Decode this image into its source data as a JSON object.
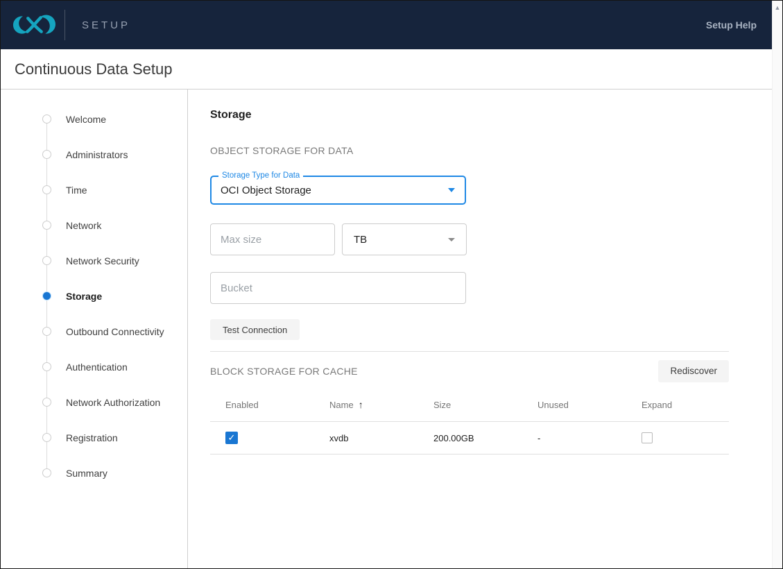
{
  "colors": {
    "header_bg": "#16243C",
    "logo_teal": "#15A4BF",
    "accent_blue": "#1E88E5",
    "active_step_blue": "#1976D2",
    "checkbox_blue": "#1976D2"
  },
  "header": {
    "product_label": "SETUP",
    "help_label": "Setup Help"
  },
  "page_title": "Continuous Data Setup",
  "stepper": {
    "steps": [
      {
        "label": "Welcome",
        "state": "pending"
      },
      {
        "label": "Administrators",
        "state": "pending"
      },
      {
        "label": "Time",
        "state": "pending"
      },
      {
        "label": "Network",
        "state": "pending"
      },
      {
        "label": "Network Security",
        "state": "pending"
      },
      {
        "label": "Storage",
        "state": "active"
      },
      {
        "label": "Outbound Connectivity",
        "state": "pending"
      },
      {
        "label": "Authentication",
        "state": "pending"
      },
      {
        "label": "Network Authorization",
        "state": "pending"
      },
      {
        "label": "Registration",
        "state": "pending"
      },
      {
        "label": "Summary",
        "state": "pending"
      }
    ]
  },
  "main": {
    "heading": "Storage",
    "object_storage": {
      "section_label": "OBJECT STORAGE FOR DATA",
      "storage_type_label": "Storage Type for Data",
      "storage_type_value": "OCI Object Storage",
      "max_size_placeholder": "Max size",
      "unit_value": "TB",
      "bucket_placeholder": "Bucket",
      "test_connection_label": "Test Connection"
    },
    "block_storage": {
      "section_label": "BLOCK STORAGE FOR CACHE",
      "rediscover_label": "Rediscover",
      "table": {
        "columns": [
          "Enabled",
          "Name",
          "Size",
          "Unused",
          "Expand"
        ],
        "sort": {
          "column": "Name",
          "direction": "ascending"
        },
        "rows": [
          {
            "enabled": true,
            "name": "xvdb",
            "size": "200.00GB",
            "unused": "-",
            "expand": false
          }
        ]
      }
    }
  },
  "icons": {
    "sort_asc": "↑",
    "check": "✓",
    "scroll_up": "▲"
  }
}
